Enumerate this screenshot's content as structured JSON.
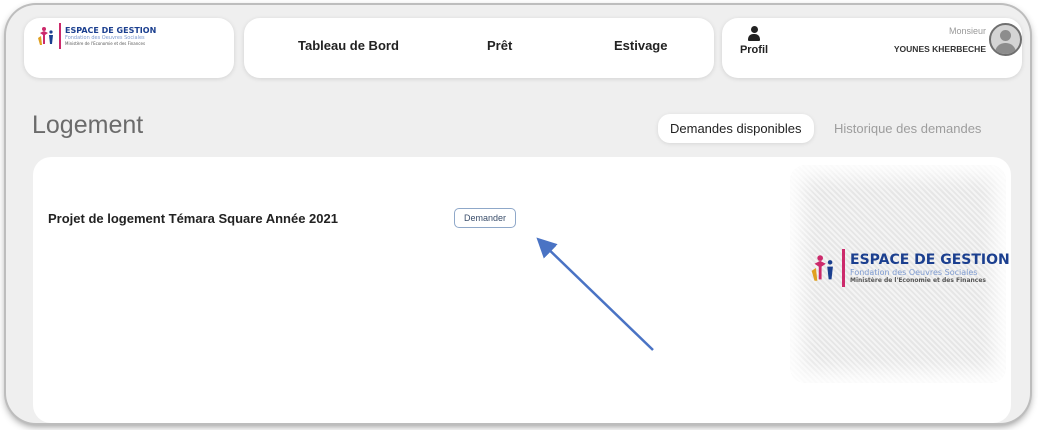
{
  "brand": {
    "title": "ESPACE DE GESTION",
    "subtitle": "Fondation des Oeuvres Sociales",
    "ministry": "Ministère de l'Economie et des Finances"
  },
  "nav": {
    "items": [
      {
        "label": "Tableau de Bord"
      },
      {
        "label": "Prêt"
      },
      {
        "label": "Estivage"
      }
    ],
    "profile_label": "Profil"
  },
  "user": {
    "salutation": "Monsieur",
    "name": "YOUNES KHERBECHE"
  },
  "page": {
    "title": "Logement",
    "tabs": [
      {
        "label": "Demandes disponibles",
        "active": true
      },
      {
        "label": "Historique des demandes",
        "active": false
      }
    ]
  },
  "requests": [
    {
      "title": "Projet de logement Témara Square Année 2021",
      "action_label": "Demander"
    }
  ],
  "colors": {
    "brand_blue": "#1b3f8f",
    "brand_pink": "#cc2a6b",
    "arrow": "#4a73c4"
  }
}
